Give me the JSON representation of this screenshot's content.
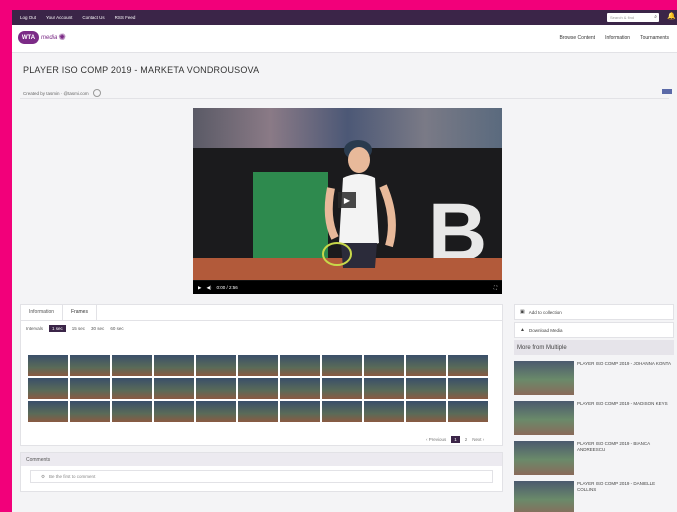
{
  "topbar": {
    "links": [
      "Log Out",
      "Your Account",
      "Contact Us",
      "RSS Feed"
    ],
    "search_placeholder": "Search & find"
  },
  "header": {
    "logo_text": "WTA",
    "logo_sub": "media",
    "nav": [
      "Browse Content",
      "Information",
      "Tournaments"
    ]
  },
  "page": {
    "title": "PLAYER ISO COMP 2019 - MARKETA VONDROUSOVA",
    "created_by": "Created by tasmin  · @tasmi.com"
  },
  "video": {
    "time": "0:00 / 2:56"
  },
  "tabs": [
    "Information",
    "Frames"
  ],
  "intervals": {
    "label": "Intervals",
    "options": [
      "1 sec",
      "15 sec",
      "30 sec",
      "60 sec"
    ]
  },
  "pager": {
    "previous": "‹ Previous",
    "pages": [
      "1",
      "2"
    ],
    "next": "Next ›"
  },
  "comments": {
    "title": "Comments",
    "placeholder": "Be the first to comment"
  },
  "sidebar": {
    "add_to_collection": "Add to collection",
    "download": "Download Media",
    "more_title": "More from Multiple",
    "related": [
      "PLAYER ISO COMP 2019 - JOHANNA KONTA",
      "PLAYER ISO COMP 2019 - MADISON KEYS",
      "PLAYER ISO COMP 2019 - BIANCA ANDREESCU",
      "PLAYER ISO COMP 2019 - DANIELLE COLLINS"
    ]
  },
  "colors": {
    "accent": "#f2007a",
    "primary": "#3b2548"
  }
}
